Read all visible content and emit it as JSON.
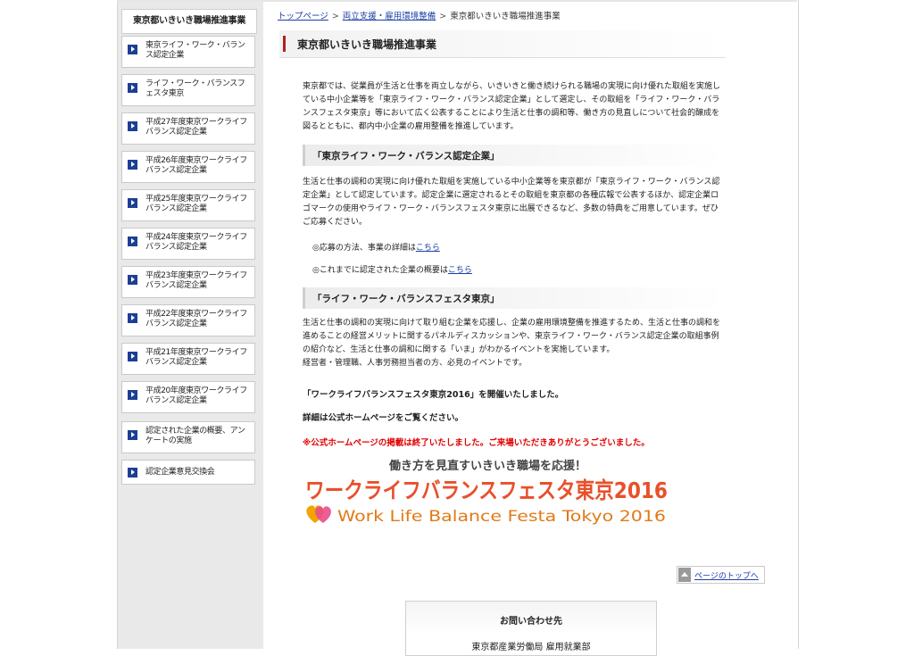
{
  "sidebar": {
    "header": "東京都いきいき職場推進事業",
    "items": [
      {
        "label": "東京ライフ・ワーク・バランス認定企業"
      },
      {
        "label": "ライフ・ワーク・バランスフェスタ東京"
      },
      {
        "label": "平成27年度東京ワークライフバランス認定企業"
      },
      {
        "label": "平成26年度東京ワークライフバランス認定企業"
      },
      {
        "label": "平成25年度東京ワークライフバランス認定企業"
      },
      {
        "label": "平成24年度東京ワークライフバランス認定企業"
      },
      {
        "label": "平成23年度東京ワークライフバランス認定企業"
      },
      {
        "label": "平成22年度東京ワークライフバランス認定企業"
      },
      {
        "label": "平成21年度東京ワークライフバランス認定企業"
      },
      {
        "label": "平成20年度東京ワークライフバランス認定企業"
      },
      {
        "label": "認定された企業の概要、アンケートの実施"
      },
      {
        "label": "認定企業意見交換会"
      }
    ]
  },
  "breadcrumb": {
    "home": "トップページ",
    "sep": ">",
    "parent": "両立支援・雇用環境整備",
    "current": "東京都いきいき職場推進事業"
  },
  "main": {
    "title": "東京都いきいき職場推進事業",
    "intro": "東京都では、従業員が生活と仕事を両立しながら、いきいきと働き続けられる職場の実現に向け優れた取組を実施している中小企業等を「東京ライフ・ワーク・バランス認定企業」として選定し、その取組を「ライフ・ワーク・バランスフェスタ東京」等において広く公表することにより生活と仕事の調和等、働き方の見直しについて社会的醸成を図るとともに、都内中小企業の雇用整備を推進しています。",
    "section1": {
      "heading": "「東京ライフ・ワーク・バランス認定企業」",
      "body": "生活と仕事の調和の実現に向け優れた取組を実施している中小企業等を東京都が「東京ライフ・ワーク・バランス認定企業」として認定しています。認定企業に選定されるとその取組を東京都の各種広報で公表するほか、認定企業ロゴマークの使用やライフ・ワーク・バランスフェスタ東京に出展できるなど、多数の特典をご用意しています。ぜひご応募ください。",
      "link1_text": "◎応募の方法、事業の詳細は",
      "link1_anchor": "こちら",
      "link2_text": "◎これまでに認定された企業の概要は",
      "link2_anchor": "こちら"
    },
    "section2": {
      "heading": "「ライフ・ワーク・バランスフェスタ東京」",
      "body": "生活と仕事の調和の実現に向けて取り組む企業を応援し、企業の雇用環境整備を推進するため、生活と仕事の調和を進めることの経営メリットに関するパネルディスカッションや、東京ライフ・ワーク・バランス認定企業の取組事例の紹介など、生活と仕事の調和に関する「いま」がわかるイベントを実施しています。",
      "body2": "経営者・管理職、人事労務担当者の方、必見のイベントです。",
      "held": "「ワークライフバランスフェスタ東京2016」を開催いたしました。",
      "details": "詳細は公式ホームページをご覧ください。",
      "notice": "※公式ホームページの掲載は終了いたしました。ご来場いただきありがとうございました。"
    },
    "logo": {
      "tagline": "働き方を見直すいきいき職場を応援！",
      "jp": "ワークライフバランスフェスタ東京2016",
      "en": "Work Life Balance Festa Tokyo 2016"
    }
  },
  "pagetop": {
    "label": "ページのトップへ"
  },
  "contact": {
    "heading": "お問い合わせ先",
    "org": "東京都産業労働局 雇用就業部"
  }
}
